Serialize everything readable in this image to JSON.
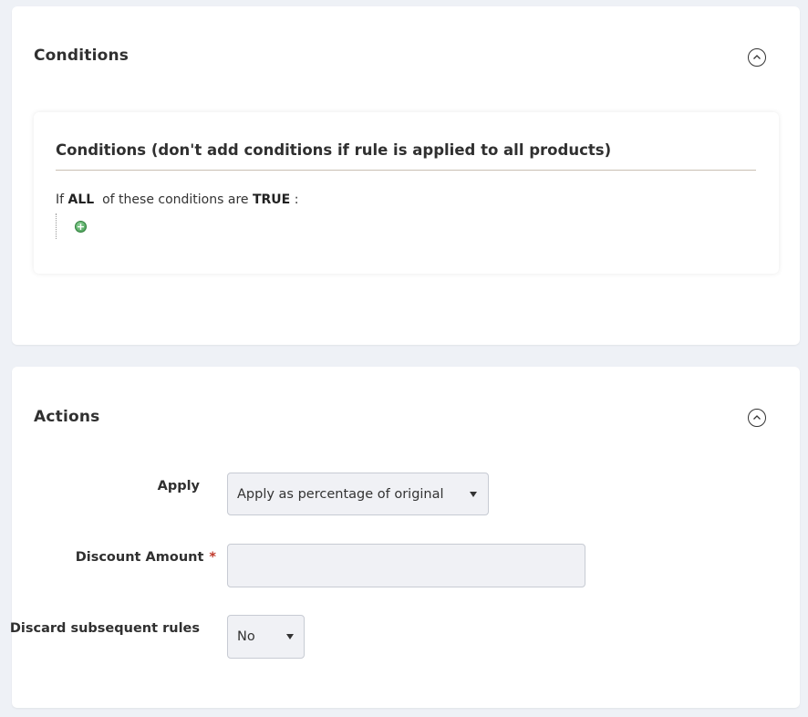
{
  "conditions_section": {
    "title": "Conditions",
    "collapse_icon": "chevron-up-circle-icon",
    "box_title": "Conditions (don't add conditions if rule is applied to all products)",
    "line": {
      "prefix": "If",
      "aggregator": "ALL",
      "middle": "of these conditions are",
      "value": "TRUE",
      "suffix": ":"
    },
    "add_icon": "add-condition-icon"
  },
  "actions_section": {
    "title": "Actions",
    "collapse_icon": "chevron-up-circle-icon",
    "apply": {
      "label": "Apply",
      "selected": "Apply as percentage of original"
    },
    "discount_amount": {
      "label": "Discount Amount",
      "required_mark": "*",
      "value": "",
      "placeholder": ""
    },
    "discard_rules": {
      "label": "Discard subsequent rules",
      "selected": "No"
    }
  },
  "colors": {
    "page_bg": "#eef1f6",
    "card_bg": "#ffffff",
    "input_bg": "#f0f1f5",
    "required": "#c0392b",
    "add_icon": "#3f9a4c"
  }
}
